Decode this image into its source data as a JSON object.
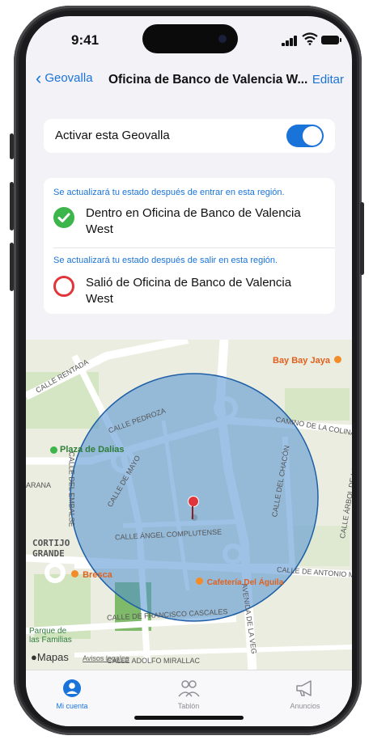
{
  "status_bar": {
    "time": "9:41"
  },
  "nav": {
    "back_label": "Geovalla",
    "title": "Oficina de Banco de Valencia W...",
    "edit_label": "Editar"
  },
  "toggle": {
    "label": "Activar esta Geovalla",
    "enabled": true
  },
  "entry": {
    "hint": "Se actualizará tu estado después de entrar en esta región.",
    "text": "Dentro en Oficina de Banco de Valencia West"
  },
  "exit": {
    "hint": "Se actualizará tu estado después de salir en esta región.",
    "text": "Salió de Oficina de Banco de Valencia West"
  },
  "map": {
    "streets": [
      "CALLE RENTADA",
      "CALLE PEDROZA",
      "CALLE DE MAYO",
      "CALLE ÁNGEL COMPLUTENSE",
      "CAMINO DE LA COLINA",
      "CALLE ÁRBOL DE LA CHACA",
      "CALLE DE ANTONIO MUÑ",
      "CALLE DE FRANCISCO CASCALES",
      "AVENIDA DE LA VEG",
      "CALLE ADOLFO MIRALLAC",
      "CALLE DEL EMBALSE",
      "CALLE DEL CHACÓN",
      "ARANA"
    ],
    "places": [
      "Plaza de Dalias",
      "CORTIJO GRANDE",
      "Parque de las Familias"
    ],
    "pois": [
      "Bay Bay Jaya",
      "Bresca",
      "Cafetería Del Águila"
    ],
    "attribution": "Mapas",
    "legal": "Avisos legales",
    "colors": {
      "geofence_fill": "#4f8fd1",
      "pin": "#e0363b"
    }
  },
  "tabs": [
    {
      "label": "Mi cuenta",
      "active": true,
      "icon": "person-circle-icon"
    },
    {
      "label": "Tablón",
      "active": false,
      "icon": "people-icon"
    },
    {
      "label": "Anuncios",
      "active": false,
      "icon": "megaphone-icon"
    }
  ],
  "colors": {
    "accent": "#1a73d9",
    "success": "#3cb54a",
    "danger": "#e0363b"
  }
}
